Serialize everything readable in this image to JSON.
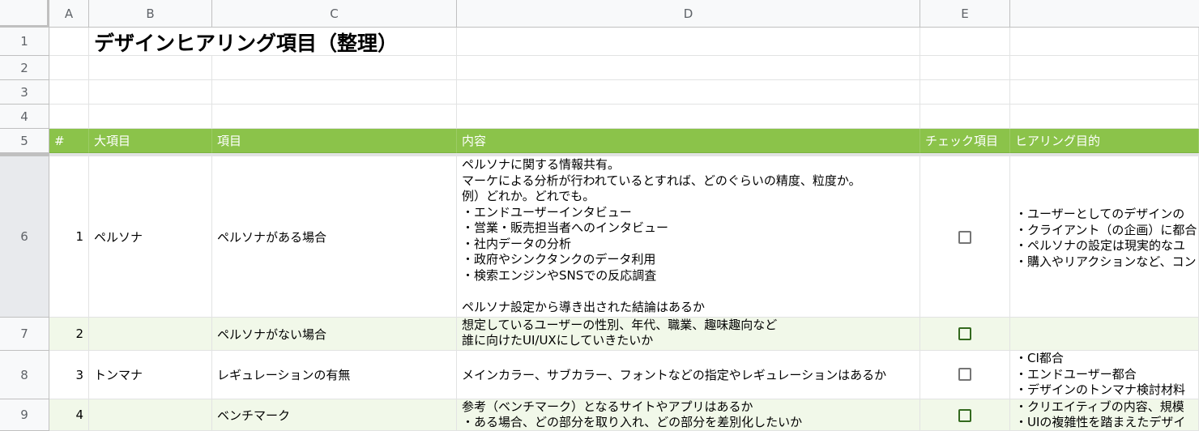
{
  "columns": [
    "A",
    "B",
    "C",
    "D",
    "E"
  ],
  "rows": [
    "1",
    "2",
    "3",
    "4",
    "5",
    "6",
    "7",
    "8",
    "9"
  ],
  "title": "デザインヒアリング項目（整理）",
  "header": {
    "num": "#",
    "category": "大項目",
    "item": "項目",
    "content": "内容",
    "check": "チェック項目",
    "purpose": "ヒアリング目的"
  },
  "entries": [
    {
      "num": "1",
      "category": "ペルソナ",
      "item": "ペルソナがある場合",
      "content": "ペルソナに関する情報共有。\nマーケによる分析が行われているとすれば、どのぐらいの精度、粒度か。\n例）どれか。どれでも。\n・エンドユーザーインタビュー\n・営業・販売担当者へのインタビュー\n・社内データの分析\n・政府やシンクタンクのデータ利用\n・検索エンジンやSNSでの反応調査\n\nペルソナ設定から導き出された結論はあるか",
      "checked": false,
      "purpose": "・ユーザーとしてのデザインの\n・クライアント（の企画）に都合\n・ペルソナの設定は現実的なユ\n・購入やリアクションなど、コン"
    },
    {
      "num": "2",
      "category": "",
      "item": "ペルソナがない場合",
      "content": "想定しているユーザーの性別、年代、職業、趣味趣向など\n誰に向けたUI/UXにしていきたいか",
      "checked": false,
      "purpose": ""
    },
    {
      "num": "3",
      "category": "トンマナ",
      "item": "レギュレーションの有無",
      "content": "メインカラー、サブカラー、フォントなどの指定やレギュレーションはあるか",
      "checked": false,
      "purpose": "・CI都合\n・エンドユーザー都合\n・デザインのトンマナ検討材料"
    },
    {
      "num": "4",
      "category": "",
      "item": "ベンチマーク",
      "content": "参考（ベンチマーク）となるサイトやアプリはあるか\n・ある場合、どの部分を取り入れ、どの部分を差別化したいか",
      "checked": false,
      "purpose": "・クリエイティブの内容、規模\n・UIの複雑性を踏まえたデザイ"
    }
  ],
  "colors": {
    "header_green": "#8bc34a",
    "band_light": "#f1f8e9",
    "checkbox_green": "#33691e",
    "gridline": "#e2e3e3"
  }
}
